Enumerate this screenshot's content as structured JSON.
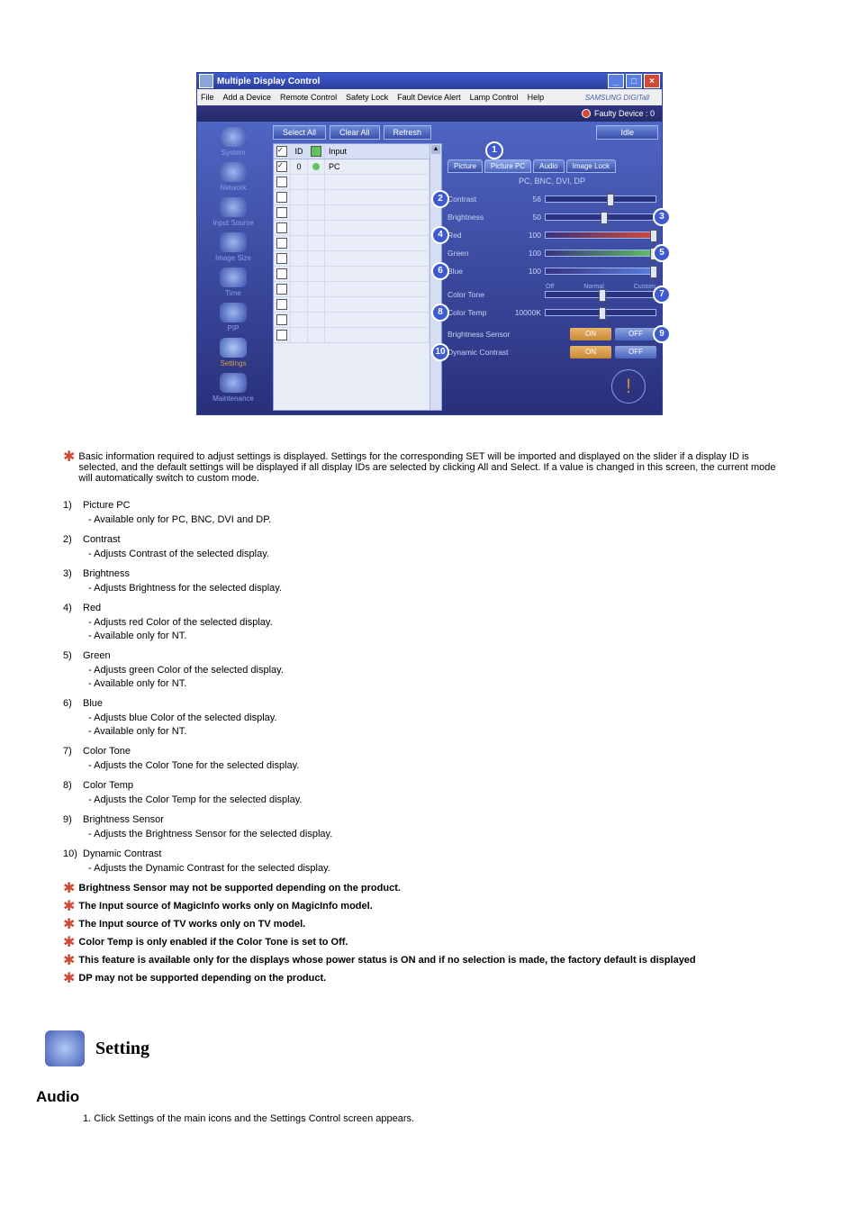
{
  "window": {
    "title": "Multiple Display Control",
    "menu": [
      "File",
      "Add a Device",
      "Remote Control",
      "Safety Lock",
      "Fault Device Alert",
      "Lamp Control",
      "Help"
    ],
    "brand": "SAMSUNG DIGITall",
    "faulty": "Faulty Device : 0",
    "buttons": {
      "select_all": "Select All",
      "clear_all": "Clear All",
      "refresh": "Refresh",
      "idle": "Idle"
    }
  },
  "sidebar": [
    {
      "label": "System",
      "sel": false
    },
    {
      "label": "Network",
      "sel": false
    },
    {
      "label": "Input Source",
      "sel": false
    },
    {
      "label": "Image Size",
      "sel": false
    },
    {
      "label": "Time",
      "sel": false
    },
    {
      "label": "PIP",
      "sel": false
    },
    {
      "label": "Settings",
      "sel": true
    },
    {
      "label": "Maintenance",
      "sel": false
    }
  ],
  "grid": {
    "headers": {
      "id": "ID",
      "input": "Input"
    },
    "rows": [
      {
        "checked": true,
        "id": "0",
        "status": "g",
        "input": "PC"
      },
      {
        "checked": false
      },
      {
        "checked": false
      },
      {
        "checked": false
      },
      {
        "checked": false
      },
      {
        "checked": false
      },
      {
        "checked": false
      },
      {
        "checked": false
      },
      {
        "checked": false
      },
      {
        "checked": false
      },
      {
        "checked": false
      },
      {
        "checked": false
      }
    ]
  },
  "panel": {
    "tabs": [
      "Picture",
      "Picture PC",
      "Audio",
      "Image Lock"
    ],
    "source": "PC, BNC, DVI, DP",
    "sliders": [
      {
        "k": "contrast",
        "label": "Contrast",
        "value": "56",
        "pos": 56,
        "cls": ""
      },
      {
        "k": "brightness",
        "label": "Brightness",
        "value": "50",
        "pos": 50,
        "cls": ""
      },
      {
        "k": "red",
        "label": "Red",
        "value": "100",
        "pos": 100,
        "cls": "r"
      },
      {
        "k": "green",
        "label": "Green",
        "value": "100",
        "pos": 100,
        "cls": "g"
      },
      {
        "k": "blue",
        "label": "Blue",
        "value": "100",
        "pos": 100,
        "cls": "b"
      }
    ],
    "colortone": {
      "label": "Color Tone",
      "opts": [
        "Off",
        "Normal",
        "Custom"
      ],
      "pos": 50
    },
    "colortemp": {
      "label": "Color Temp",
      "value": "10000K",
      "pos": 50
    },
    "bsensor": {
      "label": "Brightness Sensor",
      "on": "ON",
      "off": "OFF"
    },
    "dcontrast": {
      "label": "Dynamic Contrast",
      "on": "ON",
      "off": "OFF"
    }
  },
  "callouts": {
    "c1": "1",
    "c2": "2",
    "c3": "3",
    "c4": "4",
    "c5": "5",
    "c6": "6",
    "c7": "7",
    "c8": "8",
    "c9": "9",
    "c10": "10"
  },
  "doc": {
    "intro": "Basic information required to adjust settings is displayed. Settings for the corresponding SET will be imported and displayed on the slider if a display ID is selected, and the default settings will be displayed if all display IDs are selected by clicking All and Select. If a value is changed in this screen, the current mode will automatically switch to custom mode.",
    "items": [
      {
        "title": "Picture PC",
        "subs": [
          "Available only for PC, BNC, DVI and DP."
        ]
      },
      {
        "title": "Contrast",
        "subs": [
          "Adjusts Contrast of the selected display."
        ]
      },
      {
        "title": "Brightness",
        "subs": [
          "Adjusts Brightness for the selected display."
        ]
      },
      {
        "title": "Red",
        "subs": [
          "Adjusts red Color of the selected display.",
          "Available  only for NT."
        ]
      },
      {
        "title": "Green",
        "subs": [
          "Adjusts green Color of the selected display.",
          "Available  only for NT."
        ]
      },
      {
        "title": "Blue",
        "subs": [
          "Adjusts blue Color of the selected display.",
          "Available  only for NT."
        ]
      },
      {
        "title": "Color Tone",
        "subs": [
          "Adjusts the Color Tone for the selected display."
        ]
      },
      {
        "title": "Color Temp",
        "subs": [
          "Adjusts the Color Temp for the selected display."
        ]
      },
      {
        "title": "Brightness Sensor",
        "subs": [
          "Adjusts the Brightness Sensor for the selected display."
        ]
      },
      {
        "title": "Dynamic Contrast",
        "subs": [
          "Adjusts the Dynamic Contrast for the selected display."
        ]
      }
    ],
    "notes": [
      "Brightness Sensor may not be supported depending on the product.",
      "The Input source of MagicInfo works only on MagicInfo model.",
      "The Input source of TV works only on TV model.",
      "Color Temp is only enabled if the Color Tone is set to Off.",
      "This feature is available only for the displays whose power status is ON and if no selection is made, the factory default is displayed",
      "DP may not be supported depending on the product."
    ],
    "setting_heading": "Setting",
    "audio_heading": "Audio",
    "audio_steps": [
      "Click Settings of the main icons and the Settings Control screen appears."
    ]
  }
}
